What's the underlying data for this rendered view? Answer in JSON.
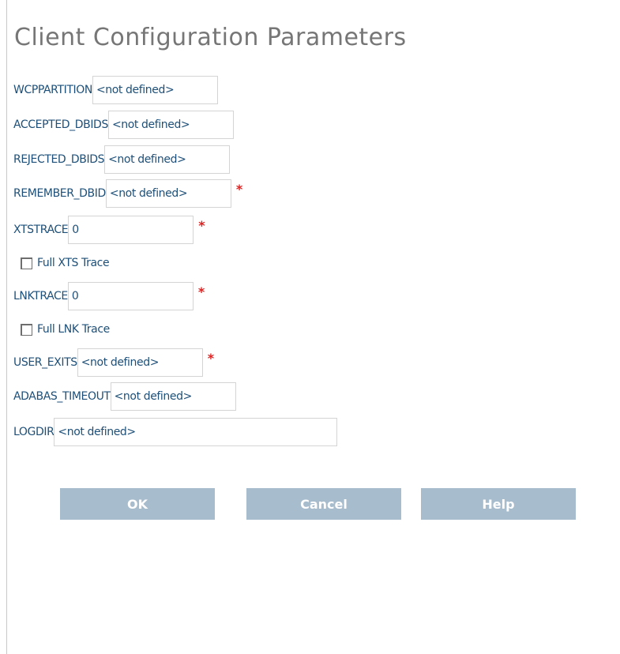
{
  "title": "Client Configuration Parameters",
  "fields": {
    "wcppartition": {
      "label": "WCPPARTITION",
      "value": "<not defined>"
    },
    "accepted_dbids": {
      "label": "ACCEPTED_DBIDS",
      "value": "<not defined>"
    },
    "rejected_dbids": {
      "label": "REJECTED_DBIDS",
      "value": "<not defined>"
    },
    "remember_dbid": {
      "label": "REMEMBER_DBID",
      "value": "<not defined>",
      "required_marker": "*"
    },
    "xtstrace": {
      "label": "XTSTRACE",
      "value": "0",
      "required_marker": "*"
    },
    "lnktrace": {
      "label": "LNKTRACE",
      "value": "0",
      "required_marker": "*"
    },
    "user_exits": {
      "label": "USER_EXITS",
      "value": "<not defined>",
      "required_marker": "*"
    },
    "adabas_timeout": {
      "label": "ADABAS_TIMEOUT",
      "value": "<not defined>"
    },
    "logdir": {
      "label": "LOGDIR",
      "value": "<not defined>"
    }
  },
  "checkboxes": {
    "full_xts_trace": {
      "label": "Full XTS Trace",
      "checked": false
    },
    "full_lnk_trace": {
      "label": "Full LNK Trace",
      "checked": false
    }
  },
  "buttons": {
    "ok": "OK",
    "cancel": "Cancel",
    "help": "Help"
  },
  "colors": {
    "label_text": "#1d4f78",
    "title_text": "#767676",
    "button_bg": "#a7bccd",
    "required_marker": "#e02020"
  }
}
